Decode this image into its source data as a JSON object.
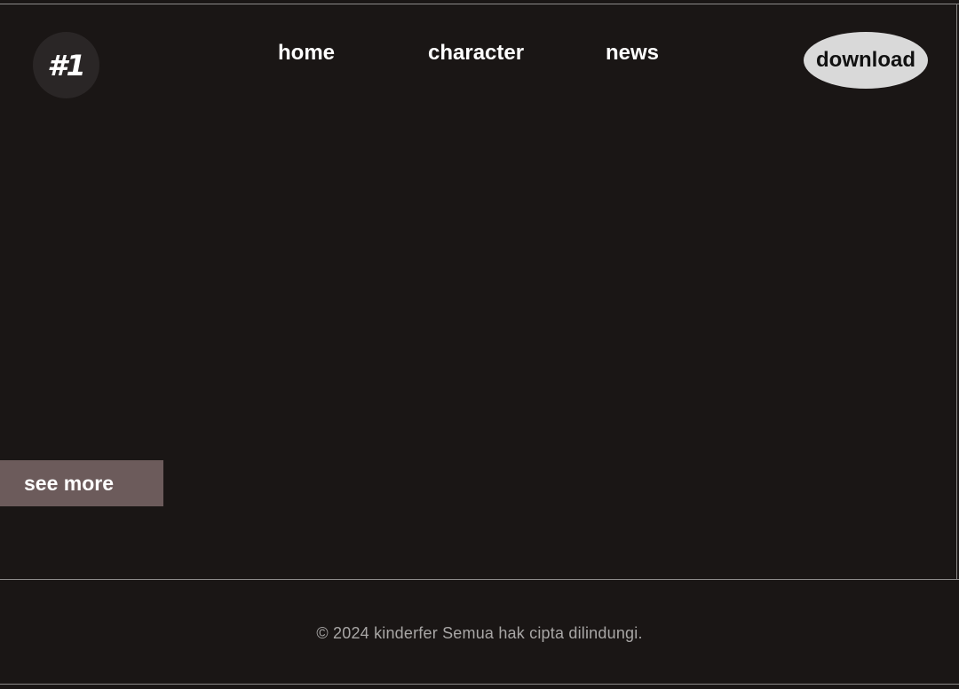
{
  "header": {
    "logo_text": "#1",
    "nav": {
      "home": "home",
      "character": "character",
      "news": "news"
    },
    "download_label": "download"
  },
  "hero": {
    "see_more_label": "see more"
  },
  "footer": {
    "copyright": "© 2024 kinderfer Semua hak cipta dilindungi."
  },
  "colors": {
    "background": "#1a1615",
    "button_light": "#d9d9d9",
    "see_more_bg": "#6c5b5b",
    "logo_bg": "#2a2626"
  }
}
